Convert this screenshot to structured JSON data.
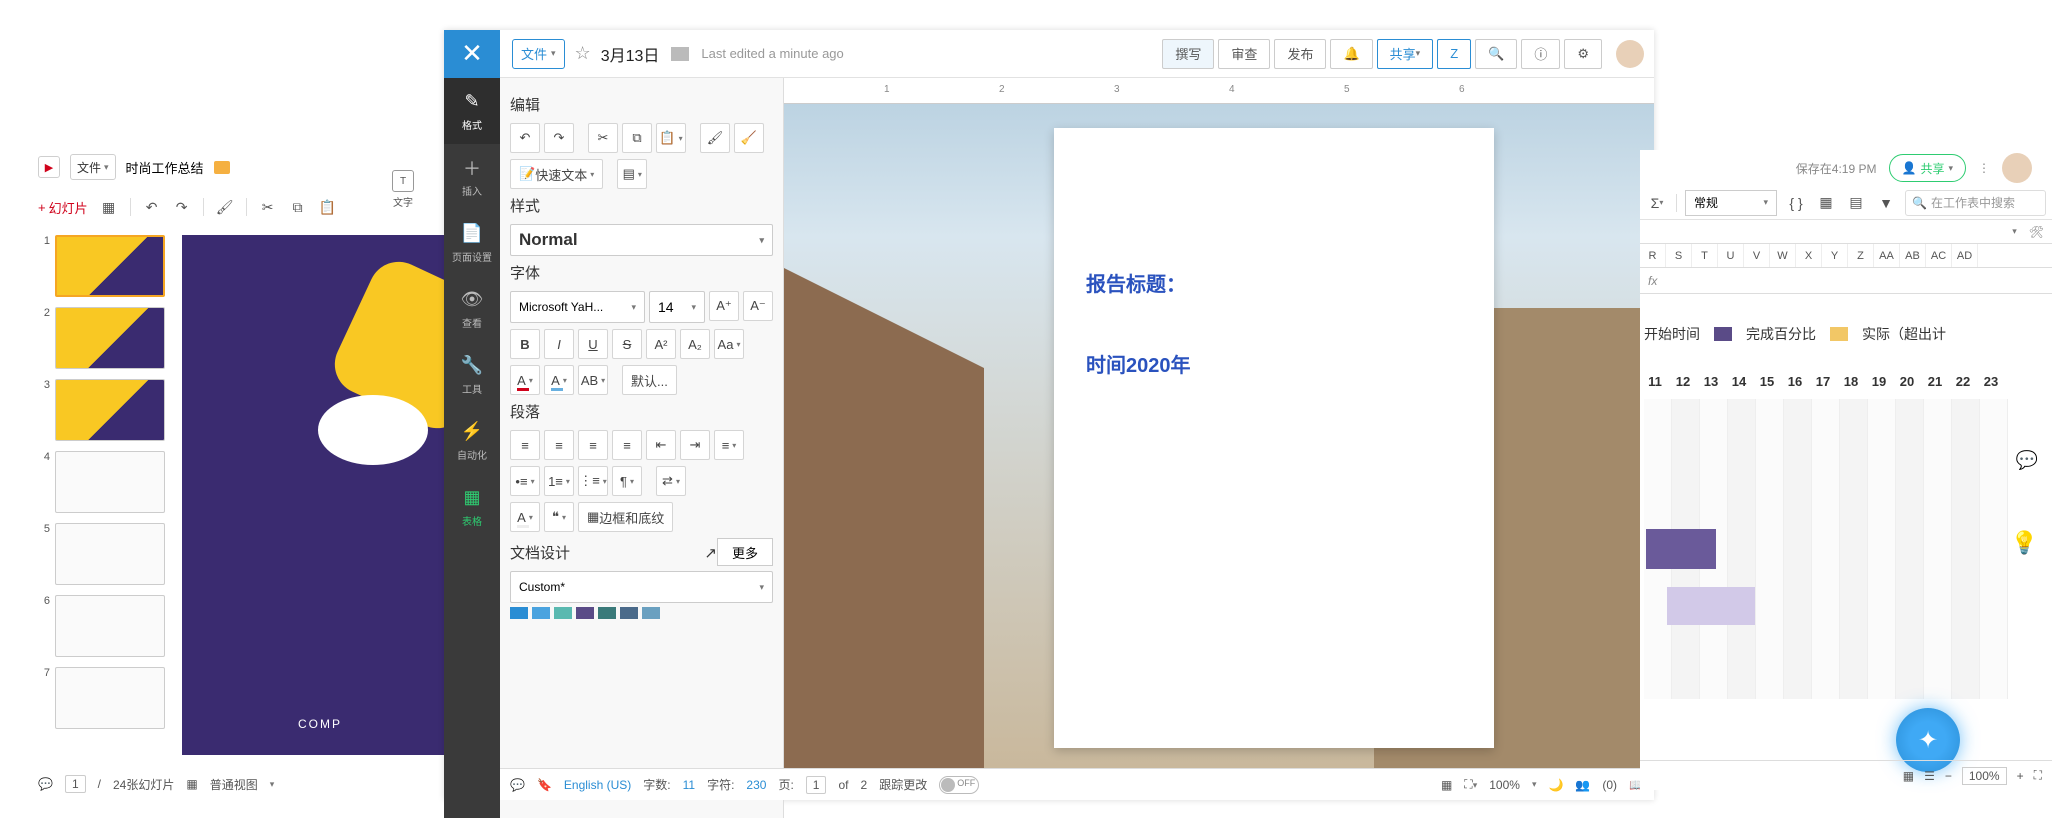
{
  "left": {
    "file_label": "文件",
    "title": "时尚工作总结",
    "add_slide": "幻灯片",
    "page_current": "1",
    "page_total": "24张幻灯片",
    "view_mode": "普通视图",
    "side_text": "文字",
    "canvas_comp": "COMP",
    "thumbs": [
      1,
      2,
      3,
      4,
      5,
      6,
      7
    ]
  },
  "mid": {
    "top": {
      "file_label": "文件",
      "date": "3月13日",
      "last_edited": "Last edited a minute ago",
      "compose": "撰写",
      "review": "审查",
      "publish": "发布",
      "share": "共享"
    },
    "rail": [
      {
        "label": "格式"
      },
      {
        "label": "插入"
      },
      {
        "label": "页面设置"
      },
      {
        "label": "查看"
      },
      {
        "label": "工具"
      },
      {
        "label": "自动化"
      },
      {
        "label": "表格"
      }
    ],
    "panel": {
      "edit": "编辑",
      "quicktext": "快速文本",
      "styles_h": "样式",
      "style_val": "Normal",
      "font_h": "字体",
      "font_family": "Microsoft YaH...",
      "font_size": "14",
      "default": "默认...",
      "para_h": "段落",
      "border": "边框和底纹",
      "more": "更多",
      "docdesign": "文档设计",
      "theme": "Custom*"
    },
    "doc": {
      "title": "报告标题：",
      "time": "时间2020年",
      "ruler_marks": [
        "1",
        "2",
        "3",
        "4",
        "5",
        "6"
      ]
    },
    "status": {
      "language": "English (US)",
      "words_label": "字数:",
      "words": "11",
      "chars_label": "字符:",
      "chars": "230",
      "page_label": "页:",
      "page_cur": "1",
      "page_of": "of",
      "page_tot": "2",
      "track": "跟踪更改",
      "zoom": "100%",
      "users": "(0)"
    }
  },
  "right": {
    "saved_at": "保存在4:19 PM",
    "share": "共享",
    "format_sel": "常规",
    "search_placeholder": "在工作表中搜索",
    "cols": [
      "R",
      "S",
      "T",
      "U",
      "V",
      "W",
      "X",
      "Y",
      "Z",
      "AA",
      "AB",
      "AC",
      "AD"
    ],
    "fx": "fx",
    "legend": {
      "start": "开始时间",
      "done": "完成百分比",
      "actual": "实际（超出计"
    },
    "timeline_nums": [
      "11",
      "12",
      "13",
      "14",
      "15",
      "16",
      "17",
      "18",
      "19",
      "20",
      "21",
      "22",
      "23"
    ],
    "zoom": "100%"
  }
}
